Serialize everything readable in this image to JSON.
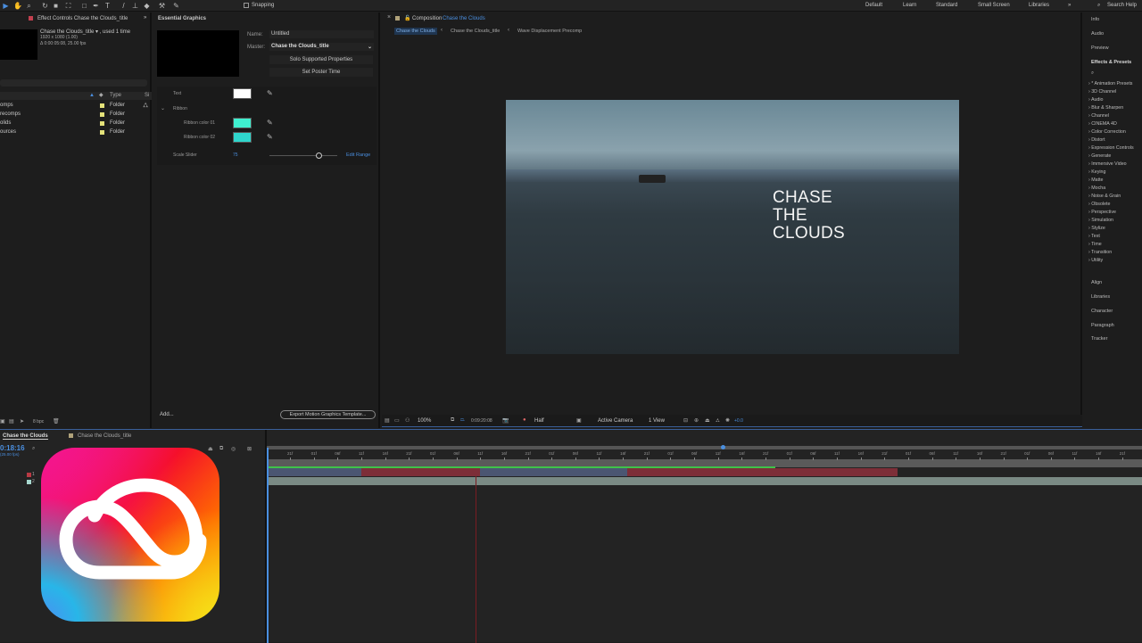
{
  "toolbar": {
    "snapping": "Snapping",
    "workspaces": [
      "Default",
      "Learn",
      "Standard",
      "Small Screen",
      "Libraries"
    ],
    "search_help": "Search Help"
  },
  "project": {
    "tab": "Effect Controls Chase the Clouds_title",
    "item_name": "Chase the Clouds_title ▾ , used 1 time",
    "item_res": "1920 x 1080 (1.00)",
    "item_dur": "Δ 0:00:05:08, 25.00 fps",
    "col_type": "Type",
    "col_size": "Si",
    "folders": [
      {
        "name": "omps",
        "type": "Folder"
      },
      {
        "name": "recomps",
        "type": "Folder"
      },
      {
        "name": "olids",
        "type": "Folder"
      },
      {
        "name": "ources",
        "type": "Folder"
      }
    ],
    "bpc": "8 bpc",
    "folder_color": "#e4e27a"
  },
  "eg": {
    "tab": "Essential Graphics",
    "name_label": "Name:",
    "name_value": "Untitled",
    "master_label": "Master:",
    "master_value": "Chase the Clouds_title",
    "solo_btn": "Solo Supported Properties",
    "poster_btn": "Set Poster Time",
    "text_label": "Text",
    "ribbon_label": "Ribbon",
    "ribbon1_label": "Ribbon color 01",
    "ribbon2_label": "Ribbon color 02",
    "scale_label": "Scale Slider",
    "scale_value": "75",
    "edit_range": "Edit Range",
    "add": "Add...",
    "export_btn": "Export Motion Graphics Template...",
    "colors": {
      "text": "#ffffff",
      "ribbon1": "#3ff0cf",
      "ribbon2": "#2fd6cc"
    }
  },
  "comp": {
    "prefix": "Composition",
    "name": "Chase the Clouds",
    "breadcrumbs": [
      "Chase the Clouds",
      "Chase the Clouds_title",
      "Wave Displacement Precomp"
    ],
    "title_lines": [
      "CHASE",
      "THE",
      "CLOUDS"
    ],
    "zoom": "100%",
    "timecode": "0:09:20:08",
    "resolution": "Half",
    "camera": "Active Camera",
    "views": "1 View",
    "exposure": "+0.0"
  },
  "right": {
    "top": [
      "Info",
      "Audio",
      "Preview"
    ],
    "effects_title": "Effects & Presets",
    "effects": [
      "* Animation Presets",
      "3D Channel",
      "Audio",
      "Blur & Sharpen",
      "Channel",
      "CINEMA 4D",
      "Color Correction",
      "Distort",
      "Expression Controls",
      "Generate",
      "Immersive Video",
      "Keying",
      "Matte",
      "Mocha",
      "Noise & Grain",
      "Obsolete",
      "Perspective",
      "Simulation",
      "Stylize",
      "Text",
      "Time",
      "Transition",
      "Utility"
    ],
    "bottom": [
      "Align",
      "Libraries",
      "Character",
      "Paragraph",
      "Tracker"
    ]
  },
  "timeline": {
    "tabs": [
      "Chase the Clouds",
      "Chase the Clouds_title"
    ],
    "timecode": "0:18:16",
    "fps": "(25.00 fps)",
    "layers": [
      "1",
      "2"
    ],
    "ruler": [
      "21f",
      "01f",
      "06f",
      "11f",
      "16f",
      "21f",
      "01f",
      "06f",
      "11f",
      "16f",
      "21f",
      "01f",
      "06f",
      "11f",
      "16f",
      "21f",
      "01f",
      "06f",
      "11f",
      "16f",
      "21f",
      "01f",
      "06f",
      "11f",
      "16f",
      "21f",
      "01f",
      "06f",
      "11f",
      "16f",
      "21f",
      "01f",
      "06f",
      "11f",
      "16f",
      "21f"
    ]
  }
}
